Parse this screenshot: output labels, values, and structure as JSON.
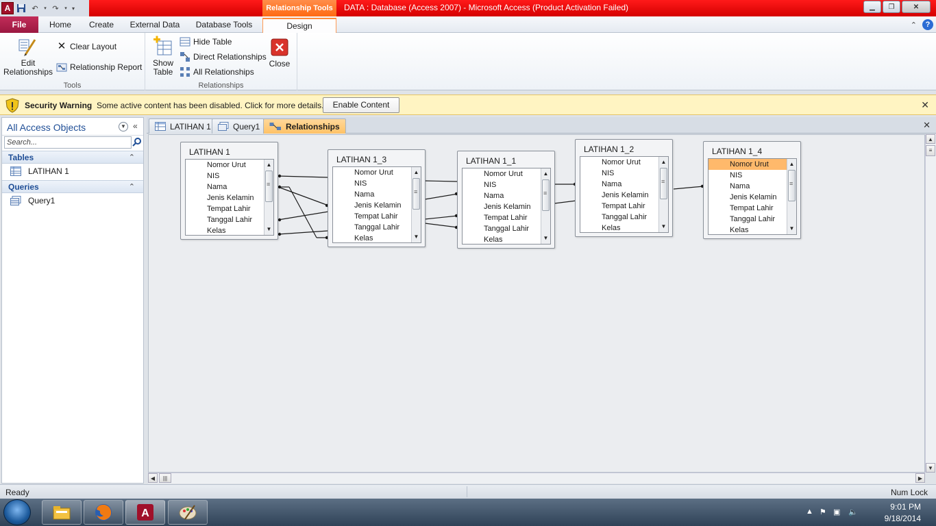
{
  "window": {
    "title": "DATA : Database (Access 2007)  -  Microsoft Access (Product Activation Failed)",
    "context_tab_title": "Relationship Tools",
    "app_icon_letter": "A"
  },
  "ribbon_tabs": [
    "File",
    "Home",
    "Create",
    "External Data",
    "Database Tools",
    "Design"
  ],
  "ribbon": {
    "tools": {
      "label": "Tools",
      "edit_relationships_line1": "Edit",
      "edit_relationships_line2": "Relationships",
      "clear_layout": "Clear Layout",
      "relationship_report": "Relationship Report"
    },
    "relationships": {
      "label": "Relationships",
      "show_table_line1": "Show",
      "show_table_line2": "Table",
      "hide_table": "Hide Table",
      "direct_relationships": "Direct Relationships",
      "all_relationships": "All Relationships",
      "close": "Close"
    }
  },
  "security_bar": {
    "title": "Security Warning",
    "message": "Some active content has been disabled. Click for more details.",
    "button": "Enable Content"
  },
  "nav_pane": {
    "title": "All Access Objects",
    "search_placeholder": "Search...",
    "sections": [
      {
        "label": "Tables",
        "items": [
          "LATIHAN 1"
        ]
      },
      {
        "label": "Queries",
        "items": [
          "Query1"
        ]
      }
    ]
  },
  "doc_tabs": [
    {
      "label": "LATIHAN 1",
      "icon": "table-icon"
    },
    {
      "label": "Query1",
      "icon": "query-icon"
    },
    {
      "label": "Relationships",
      "icon": "relationships-icon",
      "active": true
    }
  ],
  "tables": [
    {
      "title": "LATIHAN 1",
      "fields": [
        "Nomor Urut",
        "NIS",
        "Nama",
        "Jenis Kelamin",
        "Tempat Lahir",
        "Tanggal Lahir",
        "Kelas"
      ],
      "selected": null
    },
    {
      "title": "LATIHAN 1_3",
      "fields": [
        "Nomor Urut",
        "NIS",
        "Nama",
        "Jenis Kelamin",
        "Tempat Lahir",
        "Tanggal Lahir",
        "Kelas"
      ],
      "selected": null
    },
    {
      "title": "LATIHAN 1_1",
      "fields": [
        "Nomor Urut",
        "NIS",
        "Nama",
        "Jenis Kelamin",
        "Tempat Lahir",
        "Tanggal Lahir",
        "Kelas"
      ],
      "selected": null
    },
    {
      "title": "LATIHAN 1_2",
      "fields": [
        "Nomor Urut",
        "NIS",
        "Nama",
        "Jenis Kelamin",
        "Tempat Lahir",
        "Tanggal Lahir",
        "Kelas"
      ],
      "selected": null
    },
    {
      "title": "LATIHAN 1_4",
      "fields": [
        "Nomor Urut",
        "NIS",
        "Nama",
        "Jenis Kelamin",
        "Tempat Lahir",
        "Tanggal Lahir",
        "Kelas"
      ],
      "selected": "Nomor Urut"
    }
  ],
  "status_bar": {
    "left": "Ready",
    "right": "Num Lock"
  },
  "taskbar": {
    "apps": [
      "file-explorer-icon",
      "firefox-icon",
      "access-icon",
      "paint-icon"
    ],
    "time": "9:01 PM",
    "date": "9/18/2014"
  },
  "colors": {
    "titlebar": "#e00000",
    "context_tab": "#ff7a2a",
    "selected_field": "#ffb96b",
    "security_bar": "#fff4c2"
  }
}
